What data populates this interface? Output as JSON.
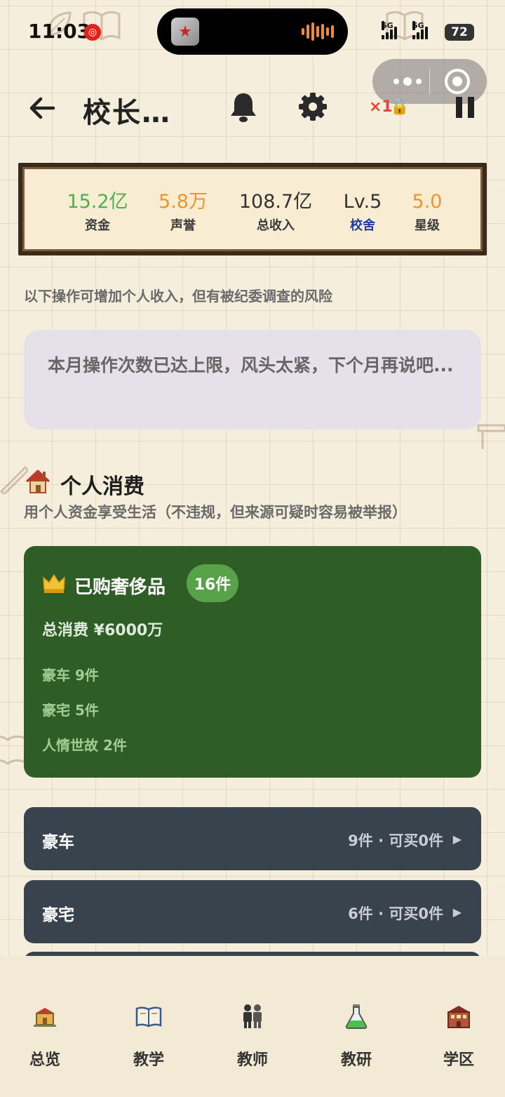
{
  "status_bar": {
    "time": "11:03",
    "signal_label_1": "5G",
    "signal_label_2": "5G",
    "battery": "72"
  },
  "header": {
    "title": "校长…",
    "speed": "×1"
  },
  "stats": [
    {
      "value": "15.2亿",
      "label": "资金",
      "value_color": "#4caf50",
      "label_color": "#3a3a3a"
    },
    {
      "value": "5.8万",
      "label": "声誉",
      "value_color": "#f0932b",
      "label_color": "#3a3a3a"
    },
    {
      "value": "108.7亿",
      "label": "总收入",
      "value_color": "#333333",
      "label_color": "#3a3a3a"
    },
    {
      "value": "Lv.5",
      "label": "校舍",
      "value_color": "#333333",
      "label_color": "#1f3aa0"
    },
    {
      "value": "5.0",
      "label": "星级",
      "value_color": "#f0932b",
      "label_color": "#3a3a3a"
    }
  ],
  "warning": {
    "text": "以下操作可增加个人收入，但有被纪委调查的风险",
    "notice": "本月操作次数已达上限，风头太紧，下个月再说吧..."
  },
  "personal": {
    "title": "个人消费",
    "subtitle": "用个人资金享受生活（不违规，但来源可疑时容易被举报）"
  },
  "luxury": {
    "title": "已购奢侈品",
    "badge": "16件",
    "total": "总消费 ¥6000万",
    "items": [
      "豪车 9件",
      "豪宅 5件",
      "人情世故 2件"
    ]
  },
  "categories": [
    {
      "name": "豪车",
      "meta": "9件 · 可买0件",
      "arrow": "▶"
    },
    {
      "name": "豪宅",
      "meta": "6件 · 可买0件",
      "arrow": "▶"
    }
  ],
  "nav": [
    {
      "label": "总览",
      "icon": "school-house-icon"
    },
    {
      "label": "教学",
      "icon": "open-book-icon"
    },
    {
      "label": "教师",
      "icon": "people-icon"
    },
    {
      "label": "教研",
      "icon": "flask-icon"
    },
    {
      "label": "学区",
      "icon": "building-icon"
    }
  ],
  "colors": {
    "luxury_card": "#2e5e26",
    "category_row": "#39434e",
    "notice_bg": "#e5e0ea",
    "background": "#f6eedd"
  }
}
